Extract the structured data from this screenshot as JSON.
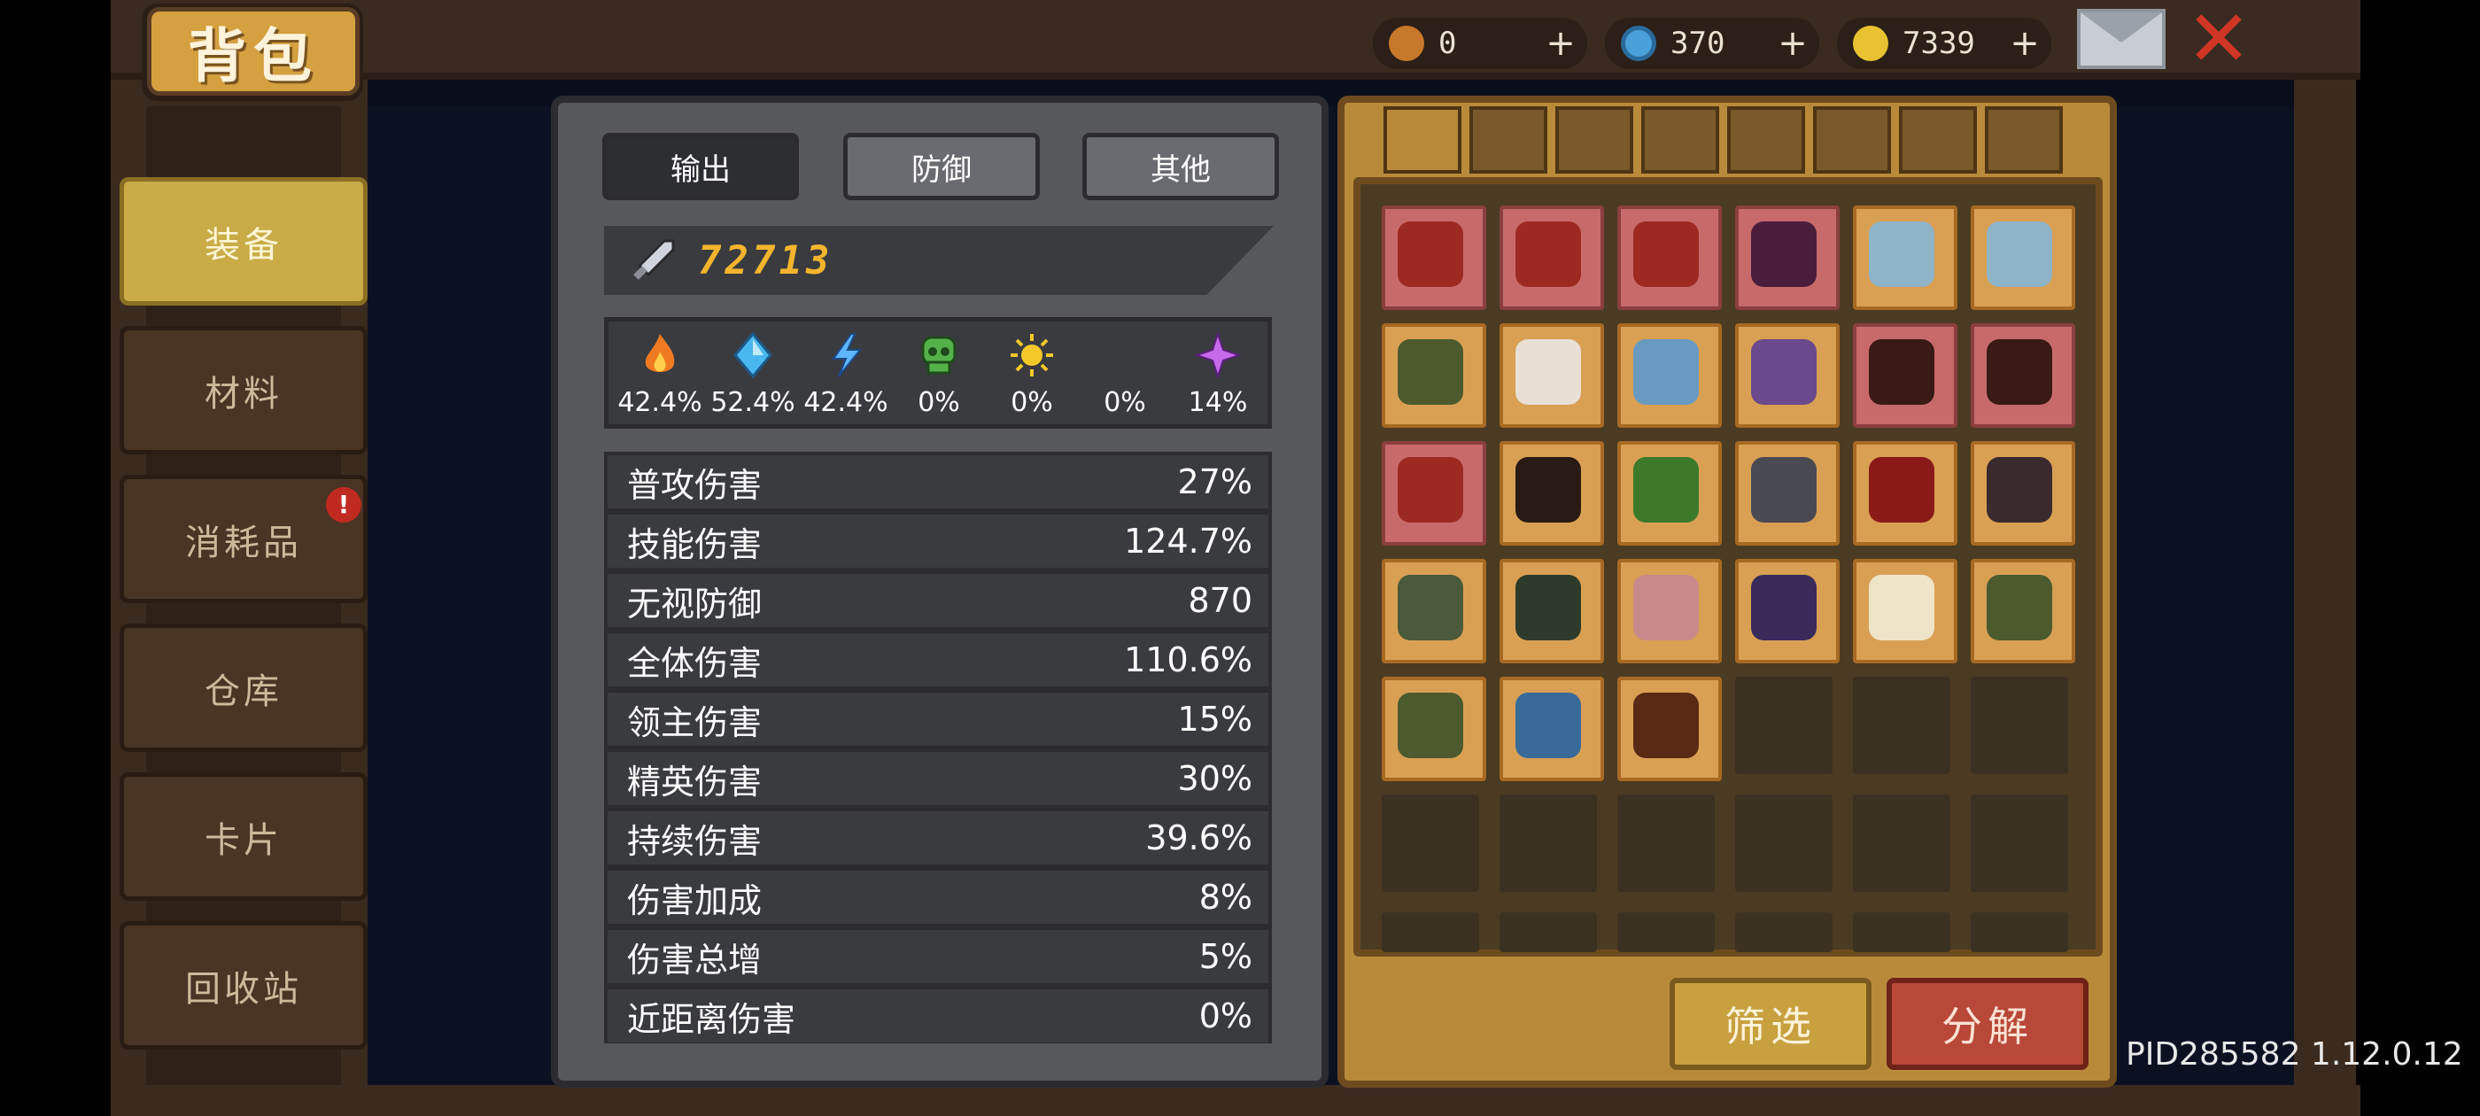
{
  "title": "背包",
  "currencies": [
    {
      "icon": "gem-bag-icon",
      "value": "0"
    },
    {
      "icon": "blue-crystal-icon",
      "value": "370"
    },
    {
      "icon": "gold-coin-icon",
      "value": "7339"
    }
  ],
  "sidebar": {
    "items": [
      {
        "label": "装备",
        "active": true
      },
      {
        "label": "材料"
      },
      {
        "label": "消耗品",
        "badge": "!"
      },
      {
        "label": "仓库"
      },
      {
        "label": "卡片"
      },
      {
        "label": "回收站"
      }
    ]
  },
  "stats": {
    "tabs": [
      {
        "label": "输出",
        "active": true
      },
      {
        "label": "防御"
      },
      {
        "label": "其他"
      }
    ],
    "power": "72713",
    "elements": [
      {
        "icon": "fire-icon",
        "value": "42.4%",
        "color": "#f07a22"
      },
      {
        "icon": "ice-crystal-icon",
        "value": "52.4%",
        "color": "#4ab8f0"
      },
      {
        "icon": "lightning-icon",
        "value": "42.4%",
        "color": "#5fb7ff"
      },
      {
        "icon": "poison-skull-icon",
        "value": "0%",
        "color": "#55b24a"
      },
      {
        "icon": "light-sun-icon",
        "value": "0%",
        "color": "#f5c82a"
      },
      {
        "icon": "dark-moon-icon",
        "value": "0%",
        "color": "#c8242a"
      },
      {
        "icon": "arcane-star-icon",
        "value": "14%",
        "color": "#c66aea"
      }
    ],
    "rows": [
      {
        "label": "普攻伤害",
        "value": "27%"
      },
      {
        "label": "技能伤害",
        "value": "124.7%"
      },
      {
        "label": "无视防御",
        "value": "870"
      },
      {
        "label": "全体伤害",
        "value": "110.6%"
      },
      {
        "label": "领主伤害",
        "value": "15%"
      },
      {
        "label": "精英伤害",
        "value": "30%"
      },
      {
        "label": "持续伤害",
        "value": "39.6%"
      },
      {
        "label": "伤害加成",
        "value": "8%"
      },
      {
        "label": "伤害总增",
        "value": "5%"
      },
      {
        "label": "近距离伤害",
        "value": "0%"
      }
    ]
  },
  "inventory": {
    "filters": [
      "all-grid-icon",
      "weapon-sword-icon",
      "armor-icon",
      "helmet-icon",
      "boots-icon",
      "necklace-icon",
      "ring-icon",
      "gear-settings-icon"
    ],
    "items": [
      {
        "name": "red-gun-item",
        "rarity": "epic",
        "color": "#9c2a22"
      },
      {
        "name": "red-gun-item",
        "rarity": "epic",
        "color": "#9c2a22"
      },
      {
        "name": "red-gun-item",
        "rarity": "epic",
        "color": "#9c2a22"
      },
      {
        "name": "dark-staff-item",
        "rarity": "epic",
        "color": "#4a1e3a"
      },
      {
        "name": "blue-hood-item",
        "rarity": "normal",
        "color": "#8fb4c8"
      },
      {
        "name": "blue-hood-item",
        "rarity": "normal",
        "color": "#8fb4c8"
      },
      {
        "name": "green-cloak-item",
        "rarity": "normal",
        "color": "#4c5a2e"
      },
      {
        "name": "white-hat-item",
        "rarity": "normal",
        "color": "#e8e0d4"
      },
      {
        "name": "blue-boots-item",
        "rarity": "normal",
        "color": "#6a9ac0"
      },
      {
        "name": "purple-boots-item",
        "rarity": "normal",
        "color": "#6a4a8a"
      },
      {
        "name": "fire-blade-item",
        "rarity": "epic",
        "color": "#3a1a14"
      },
      {
        "name": "fire-blade-item",
        "rarity": "epic",
        "color": "#3a1a14"
      },
      {
        "name": "red-gun-item",
        "rarity": "epic",
        "color": "#9c2a22"
      },
      {
        "name": "dark-bow-item",
        "rarity": "normal",
        "color": "#2a1a14"
      },
      {
        "name": "green-blade-item",
        "rarity": "normal",
        "color": "#3c7a2a"
      },
      {
        "name": "iron-helmet-item",
        "rarity": "normal",
        "color": "#4a4a52"
      },
      {
        "name": "red-armor-item",
        "rarity": "normal",
        "color": "#8a1a18"
      },
      {
        "name": "dark-armor-item",
        "rarity": "normal",
        "color": "#3a2a2e"
      },
      {
        "name": "green-armor-item",
        "rarity": "normal",
        "color": "#4a5a3a"
      },
      {
        "name": "gem-ring-item",
        "rarity": "normal",
        "color": "#2e3a2a"
      },
      {
        "name": "pink-ring-item",
        "rarity": "normal",
        "color": "#c88a8a"
      },
      {
        "name": "rune-amulet-item",
        "rarity": "normal",
        "color": "#3a2a5a"
      },
      {
        "name": "white-cap-item",
        "rarity": "normal",
        "color": "#efe4c8"
      },
      {
        "name": "green-cloak-item",
        "rarity": "normal",
        "color": "#4c5a2e"
      },
      {
        "name": "green-cloak-item",
        "rarity": "normal",
        "color": "#4c5a2e"
      },
      {
        "name": "blue-robe-item",
        "rarity": "normal",
        "color": "#3a6a9a"
      },
      {
        "name": "flame-vest-item",
        "rarity": "normal",
        "color": "#5a2a14"
      }
    ],
    "filter_label": "筛选",
    "decompose_label": "分解"
  },
  "pid": "PID285582 1.12.0.12"
}
